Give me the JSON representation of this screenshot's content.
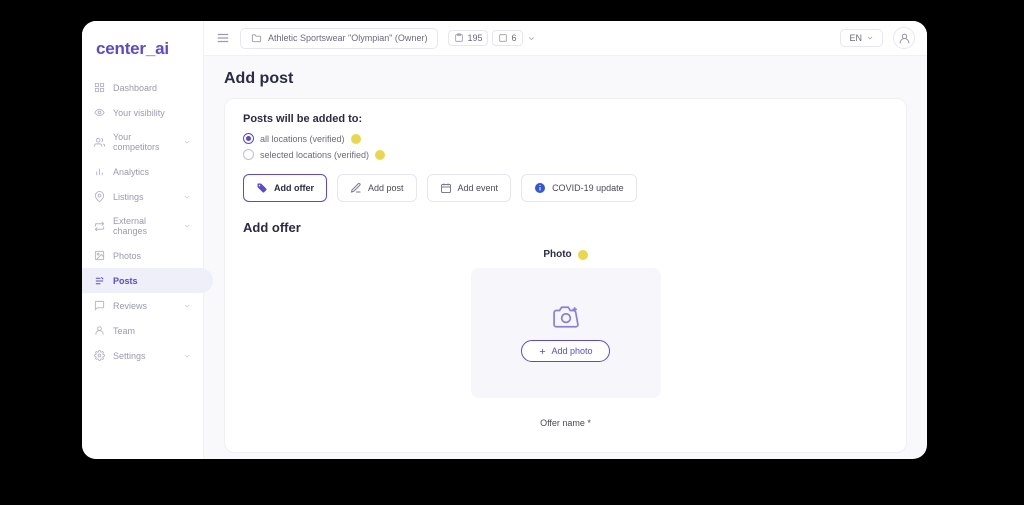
{
  "brand": "center_ai",
  "topbar": {
    "folder_label": "Athletic Sportswear \"Olympian\" (Owner)",
    "stat1": "195",
    "stat2": "6",
    "language": "EN"
  },
  "sidebar": {
    "items": [
      {
        "label": "Dashboard",
        "expandable": false
      },
      {
        "label": "Your visibility",
        "expandable": false
      },
      {
        "label": "Your competitors",
        "expandable": true
      },
      {
        "label": "Analytics",
        "expandable": false
      },
      {
        "label": "Listings",
        "expandable": true
      },
      {
        "label": "External changes",
        "expandable": true
      },
      {
        "label": "Photos",
        "expandable": false
      },
      {
        "label": "Posts",
        "expandable": false,
        "active": true
      },
      {
        "label": "Reviews",
        "expandable": true
      },
      {
        "label": "Team",
        "expandable": false
      },
      {
        "label": "Settings",
        "expandable": true
      }
    ]
  },
  "page": {
    "title": "Add post",
    "scope_title": "Posts will be added to:",
    "radio_all": "all locations (verified)",
    "radio_selected": "selected locations (verified)",
    "type_buttons": {
      "offer": "Add offer",
      "post": "Add post",
      "event": "Add event",
      "covid": "COVID-19 update"
    },
    "section_title": "Add offer",
    "photo_label": "Photo",
    "add_photo_btn": "Add photo",
    "offer_name_label": "Offer name *"
  }
}
